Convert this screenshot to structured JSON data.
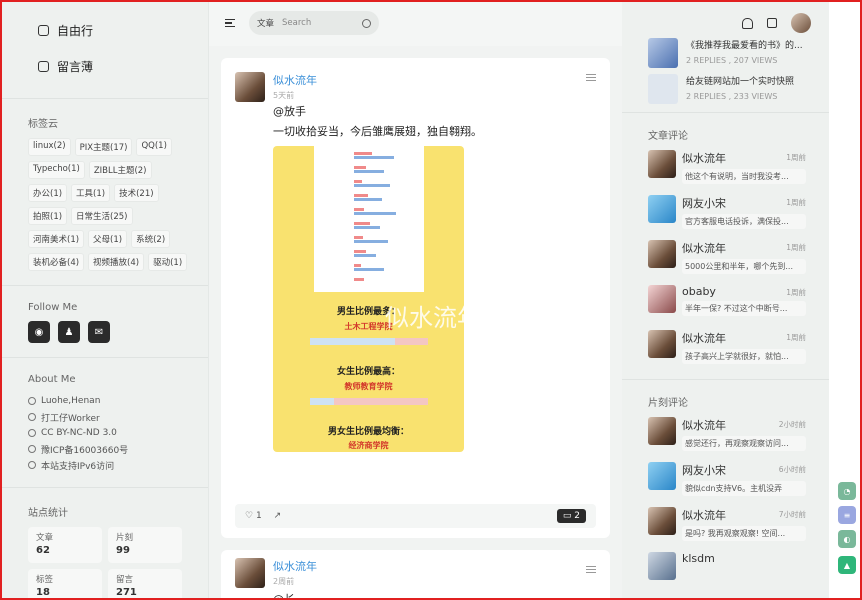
{
  "nav": {
    "items": [
      {
        "label": "自由行",
        "icon": "compass-icon"
      },
      {
        "label": "留言薄",
        "icon": "edit-icon"
      }
    ]
  },
  "tags_title": "标签云",
  "tags": [
    "linux(2)",
    "PIX主题(17)",
    "QQ(1)",
    "Typecho(1)",
    "ZIBLL主题(2)",
    "办公(1)",
    "工具(1)",
    "技术(21)",
    "拍照(1)",
    "日常生活(25)",
    "河南美术(1)",
    "父母(1)",
    "系统(2)",
    "装机必备(4)",
    "视频播放(4)",
    "驱动(1)"
  ],
  "follow": {
    "title": "Follow Me",
    "icons": [
      "weibo-icon",
      "qq-icon",
      "mail-icon"
    ]
  },
  "about": {
    "title": "About Me",
    "rows": [
      "Luohe,Henan",
      "打工仔Worker",
      "CC BY-NC-ND 3.0",
      "豫ICP备16003660号",
      "本站支持IPv6访问"
    ]
  },
  "stats": {
    "title": "站点统计",
    "items": [
      {
        "label": "文章",
        "value": "62"
      },
      {
        "label": "片刻",
        "value": "99"
      },
      {
        "label": "标签",
        "value": "18"
      },
      {
        "label": "留言",
        "value": "271"
      }
    ]
  },
  "search": {
    "type": "文章",
    "placeholder": "Search"
  },
  "posts": [
    {
      "author": "似水流年",
      "time": "5天前",
      "title": "@放手",
      "body": "一切收拾妥当，今后雏鹰展翅，独自翱翔。",
      "likes": "1",
      "comments": "2"
    },
    {
      "author": "似水流年",
      "time": "2周前",
      "title": "@长"
    }
  ],
  "infographic": {
    "male_title": "男生比例最多：",
    "male_school": "土木工程学院",
    "male_pct": [
      "28%",
      "72%"
    ],
    "female_title": "女生比例最高：",
    "female_school": "教师教育学院",
    "female_pct": [
      "20%",
      "80%"
    ],
    "balance_title": "男女生比例最均衡：",
    "balance_school": "经济商学院"
  },
  "watermark": "似水流年",
  "trending": [
    {
      "title": "《我推荐我最爱看的书》的...",
      "meta": "2 REPLIES , 207 VIEWS"
    },
    {
      "title": "给友链网站加一个实时快照",
      "meta": "2 REPLIES , 233 VIEWS"
    }
  ],
  "article_comments": {
    "title": "文章评论",
    "items": [
      {
        "name": "似水流年",
        "time": "1周前",
        "text": "他这个有说明，当时我没考..."
      },
      {
        "name": "网友小宋",
        "time": "1周前",
        "text": "官方客服电话投诉，满保投..."
      },
      {
        "name": "似水流年",
        "time": "1周前",
        "text": "5000公里和半年，哪个先到..."
      },
      {
        "name": "obaby",
        "time": "1周前",
        "text": "半年一保? 不过这个中断号..."
      },
      {
        "name": "似水流年",
        "time": "1周前",
        "text": "孩子高兴上学就很好，就怕..."
      }
    ]
  },
  "moment_comments": {
    "title": "片刻评论",
    "items": [
      {
        "name": "似水流年",
        "time": "2小时前",
        "text": "感觉还行，再观察观察访问..."
      },
      {
        "name": "网友小宋",
        "time": "6小时前",
        "text": "貌似cdn支持V6。主机没弄"
      },
      {
        "name": "似水流年",
        "time": "7小时前",
        "text": "是吗? 我再观察观察! 空间..."
      },
      {
        "name": "klsdm",
        "time": "",
        "text": ""
      }
    ]
  },
  "colors": {
    "accent": "#3a8fd8",
    "float_green": "#2fb67a",
    "float_gray": "#7ab89a"
  }
}
